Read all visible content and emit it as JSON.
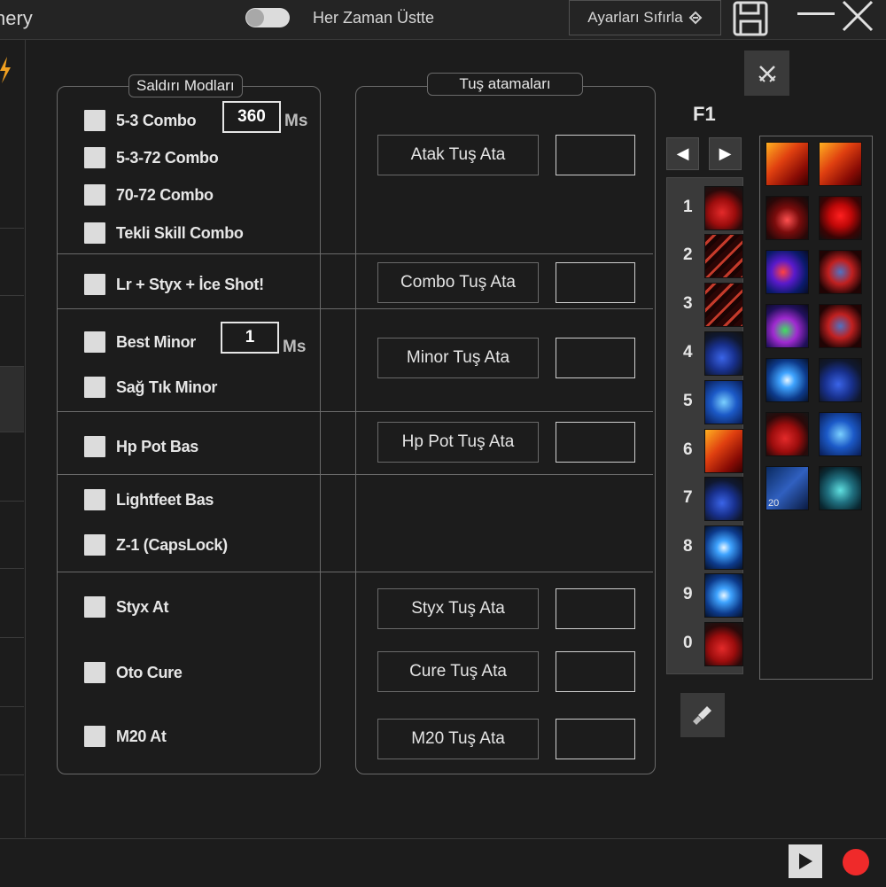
{
  "titlebar": {
    "app_title": "nery",
    "always_on_top_label": "Her Zaman Üstte",
    "reset_label": "Ayarları Sıfırla",
    "icons": [
      "toggle-icon",
      "reset-icon",
      "save-icon",
      "minimize-icon",
      "close-icon"
    ]
  },
  "attack_modes": {
    "legend": "Saldırı Modları",
    "combo_delay": "360",
    "minor_delay": "1",
    "unit": "Ms",
    "options": {
      "combo_53": "5-3 Combo",
      "combo_5372": "5-3-72 Combo",
      "combo_7072": "70-72 Combo",
      "single_skill": "Tekli Skill Combo",
      "lr_styx_ice": "Lr + Styx + İce Shot!",
      "best_minor": "Best Minor",
      "right_click_minor": "Sağ Tık Minor",
      "hp_pot": "Hp Pot Bas",
      "lightfeet": "Lightfeet Bas",
      "z1_capslock": "Z-1 (CapsLock)",
      "styx": "Styx At",
      "cure": "Oto Cure",
      "m20": "M20 At"
    }
  },
  "key_bindings": {
    "legend": "Tuş atamaları",
    "attack": "Atak Tuş Ata",
    "combo": "Combo Tuş Ata",
    "minor": "Minor Tuş Ata",
    "hp_pot": "Hp Pot Tuş Ata",
    "styx": "Styx Tuş Ata",
    "cure": "Cure Tuş Ata",
    "m20": "M20 Tuş Ata"
  },
  "skillbar": {
    "page": "F1",
    "slots": [
      {
        "num": "1",
        "icon": "red-potion-icon"
      },
      {
        "num": "2",
        "icon": "arrows-skill-icon"
      },
      {
        "num": "3",
        "icon": "arrows-skill-icon"
      },
      {
        "num": "4",
        "icon": "blue-potion-icon"
      },
      {
        "num": "5",
        "icon": "lightfeet-icon"
      },
      {
        "num": "6",
        "icon": "fire-arrow-icon"
      },
      {
        "num": "7",
        "icon": "blue-potion-icon"
      },
      {
        "num": "8",
        "icon": "spark-skill-icon"
      },
      {
        "num": "9",
        "icon": "spark-skill-icon"
      },
      {
        "num": "0",
        "icon": "red-potion-icon"
      }
    ]
  },
  "skill_grid": {
    "icons": [
      "fire-arrow-icon",
      "fire-arrow-icon",
      "red-eye-skill-icon",
      "blood-skill-icon",
      "blue-swirl-icon",
      "shadow-skill-icon",
      "vortex-skill-icon",
      "shadow-skill-icon",
      "spark-skill-icon",
      "blue-potion-icon",
      "red-potion-icon",
      "lightfeet-icon",
      "bow-skill-icon",
      "jar-icon"
    ],
    "badge": "20"
  },
  "colors": {
    "background": "#1c1c1c",
    "record": "#ef2a2a"
  }
}
